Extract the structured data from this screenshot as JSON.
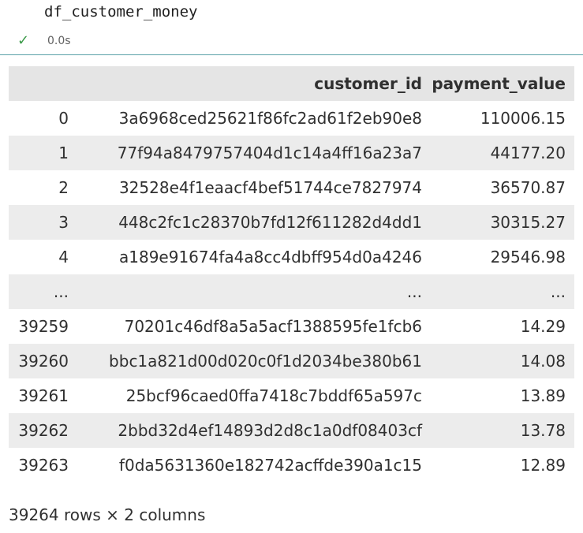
{
  "cell": {
    "code": "df_customer_money",
    "status_icon": "check-icon",
    "exec_time": "0.0s",
    "status_color": "#3c9a4a",
    "divider_color": "#5aa1a8"
  },
  "dataframe": {
    "columns": [
      "",
      "customer_id",
      "payment_value"
    ],
    "rows": [
      [
        "0",
        "3a6968ced25621f86fc2ad61f2eb90e8",
        "110006.15"
      ],
      [
        "1",
        "77f94a8479757404d1c14a4ff16a23a7",
        "44177.20"
      ],
      [
        "2",
        "32528e4f1eaacf4bef51744ce7827974",
        "36570.87"
      ],
      [
        "3",
        "448c2fc1c28370b7fd12f611282d4dd1",
        "30315.27"
      ],
      [
        "4",
        "a189e91674fa4a8cc4dbff954d0a4246",
        "29546.98"
      ],
      [
        "...",
        "...",
        "..."
      ],
      [
        "39259",
        "70201c46df8a5a5acf1388595fe1fcb6",
        "14.29"
      ],
      [
        "39260",
        "bbc1a821d00d020c0f1d2034be380b61",
        "14.08"
      ],
      [
        "39261",
        "25bcf96caed0ffa7418c7bddf65a597c",
        "13.89"
      ],
      [
        "39262",
        "2bbd32d4ef14893d2d8c1a0df08403cf",
        "13.78"
      ],
      [
        "39263",
        "f0da5631360e182742acffde390a1c15",
        "12.89"
      ]
    ],
    "shape_text": "39264 rows × 2 columns"
  }
}
